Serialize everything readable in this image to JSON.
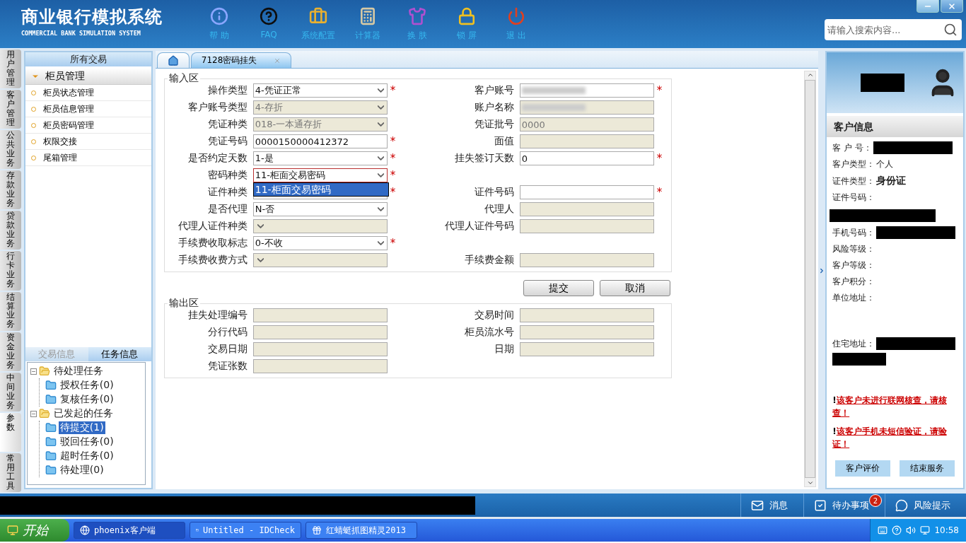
{
  "required_mark": "*",
  "header": {
    "title": "商业银行模拟系统",
    "subtitle": "COMMERCIAL BANK SIMULATION SYSTEM",
    "tools": [
      {
        "label": "帮 助",
        "kind": "info"
      },
      {
        "label": "FAQ",
        "kind": "help"
      },
      {
        "label": "系统配置",
        "kind": "toolbox"
      },
      {
        "label": "计算器",
        "kind": "calculator"
      },
      {
        "label": "换 肤",
        "kind": "shirt"
      },
      {
        "label": "锁 屏",
        "kind": "lock"
      },
      {
        "label": "退 出",
        "kind": "power"
      }
    ],
    "search": {
      "placeholder": "请输入搜索内容..."
    }
  },
  "vertical_tabs": [
    {
      "label": "用户管理",
      "selected": false
    },
    {
      "label": "客户管理",
      "selected": false
    },
    {
      "label": "公共业务",
      "selected": false
    },
    {
      "label": "存款业务",
      "selected": false
    },
    {
      "label": "贷款业务",
      "selected": false
    },
    {
      "label": "行卡业务",
      "selected": false
    },
    {
      "label": "结算业务",
      "selected": false
    },
    {
      "label": "资金业务",
      "selected": false
    },
    {
      "label": "中间业务",
      "selected": false
    },
    {
      "label": "参数",
      "selected": true
    },
    {
      "label": "常用工具",
      "selected": false
    }
  ],
  "left_panel": {
    "title": "所有交易",
    "section": {
      "label": "柜员管理",
      "expanded": true,
      "items": [
        "柜员状态管理",
        "柜员信息管理",
        "柜员密码管理",
        "权限交接",
        "尾箱管理"
      ]
    },
    "bottom_tabs": [
      {
        "label": "交易信息",
        "selected": false
      },
      {
        "label": "任务信息",
        "selected": true
      }
    ],
    "tree": [
      {
        "label": "待处理任务",
        "expanded": true,
        "children": [
          {
            "label": "授权任务(0)",
            "selected": false
          },
          {
            "label": "复核任务(0)",
            "selected": false
          }
        ]
      },
      {
        "label": "已发起的任务",
        "expanded": true,
        "children": [
          {
            "label": "待提交(1)",
            "selected": true
          },
          {
            "label": "驳回任务(0)",
            "selected": false
          },
          {
            "label": "超时任务(0)",
            "selected": false
          },
          {
            "label": "待处理(0)",
            "selected": false
          }
        ]
      }
    ]
  },
  "page_tabs": [
    {
      "kind": "home",
      "selected": false
    },
    {
      "kind": "page",
      "label": "7128密码挂失",
      "selected": true
    }
  ],
  "input": {
    "legend": "输入区",
    "rows": [
      {
        "left": {
          "label": "操作类型",
          "kind": "select",
          "value": "4-凭证正常",
          "disabled": false,
          "required": true
        },
        "right": {
          "label": "客户账号",
          "kind": "text",
          "redacted": true,
          "disabled": false,
          "required": true
        }
      },
      {
        "left": {
          "label": "客户账号类型",
          "kind": "select",
          "value": "4-存折",
          "disabled": true
        },
        "right": {
          "label": "账户名称",
          "kind": "text",
          "redacted": true,
          "disabled": true
        }
      },
      {
        "left": {
          "label": "凭证种类",
          "kind": "select",
          "value": "018-一本通存折",
          "disabled": true
        },
        "right": {
          "label": "凭证批号",
          "kind": "text",
          "value": "0000",
          "disabled": true
        }
      },
      {
        "left": {
          "label": "凭证号码",
          "kind": "text",
          "value": "0000150000412372",
          "disabled": false,
          "required": true
        },
        "right": {
          "label": "面值",
          "kind": "text",
          "disabled": true
        }
      },
      {
        "left": {
          "label": "是否约定天数",
          "kind": "select",
          "value": "1-是",
          "disabled": false,
          "required": true
        },
        "right": {
          "label": "挂失签订天数",
          "kind": "text",
          "value": "0",
          "disabled": false,
          "required": true
        }
      },
      {
        "left": {
          "label": "密码种类",
          "kind": "select",
          "value": "11-柜面交易密码",
          "disabled": false,
          "required": true,
          "open": true,
          "options": [
            {
              "label": "11-柜面交易密码",
              "selected": true
            }
          ]
        }
      },
      {
        "left": {
          "label": "证件种类",
          "kind": "select",
          "disabled": false,
          "required": true
        },
        "right": {
          "label": "证件号码",
          "kind": "text",
          "disabled": false,
          "required": true
        }
      },
      {
        "left": {
          "label": "是否代理",
          "kind": "select",
          "value": "N-否",
          "disabled": false
        },
        "right": {
          "label": "代理人",
          "kind": "text",
          "disabled": true
        }
      },
      {
        "left": {
          "label": "代理人证件种类",
          "kind": "select",
          "disabled": true
        },
        "right": {
          "label": "代理人证件号码",
          "kind": "text",
          "disabled": true
        }
      },
      {
        "left": {
          "label": "手续费收取标志",
          "kind": "select",
          "value": "0-不收",
          "disabled": false,
          "required": true
        }
      },
      {
        "left": {
          "label": "手续费收费方式",
          "kind": "select",
          "disabled": true
        },
        "right": {
          "label": "手续费金额",
          "kind": "text",
          "disabled": true
        }
      }
    ]
  },
  "buttons": [
    "提交",
    "取消"
  ],
  "output": {
    "legend": "输出区",
    "rows": [
      {
        "left": {
          "label": "挂失处理编号",
          "kind": "text",
          "disabled": true
        },
        "right": {
          "label": "交易时间",
          "kind": "text",
          "disabled": true
        }
      },
      {
        "left": {
          "label": "分行代码",
          "kind": "text",
          "disabled": true
        },
        "right": {
          "label": "柜员流水号",
          "kind": "text",
          "disabled": true
        }
      },
      {
        "left": {
          "label": "交易日期",
          "kind": "text",
          "disabled": true
        },
        "right": {
          "label": "日期",
          "kind": "text",
          "disabled": true
        }
      },
      {
        "left": {
          "label": "凭证张数",
          "kind": "text",
          "disabled": true
        }
      }
    ]
  },
  "customer": {
    "title": "客户信息",
    "items": [
      {
        "label": "客 户 号：",
        "kind": "redacted_inline"
      },
      {
        "label": "客户类型：",
        "kind": "text",
        "value": "个人"
      },
      {
        "label": "证件类型：",
        "kind": "bold",
        "value": "身份证"
      },
      {
        "label": "证件号码：",
        "kind": "redacted_below"
      },
      {
        "label": "手机号码：",
        "kind": "redacted_inline"
      },
      {
        "label": "风险等级：",
        "kind": "text"
      },
      {
        "label": "客户等级：",
        "kind": "text"
      },
      {
        "label": "客户积分：",
        "kind": "text"
      },
      {
        "label": "单位地址：",
        "kind": "tall"
      },
      {
        "label": "住宅地址：",
        "kind": "redacted_wrap"
      }
    ],
    "warnings": [
      {
        "mark": "!",
        "text": "该客户未进行联网核查，请核查！"
      },
      {
        "mark": "!",
        "text": "该客户手机未短信验证，请验证！"
      }
    ],
    "buttons": [
      "客户评价",
      "结束服务"
    ]
  },
  "status_bar": {
    "items": [
      {
        "label": "消息",
        "kind": "mail"
      },
      {
        "label": "待办事项",
        "kind": "check",
        "badge": "2"
      },
      {
        "label": "风险提示",
        "kind": "chat"
      }
    ]
  },
  "taskbar": {
    "start": "开始",
    "tasks": [
      {
        "label": "phoenix客户端",
        "selected": true,
        "kind": "globe"
      },
      {
        "label": "Untitled - IDCheck",
        "selected": false,
        "kind": "window"
      },
      {
        "label": "红蜻蜓抓图精灵2013",
        "selected": false,
        "kind": "gift"
      }
    ],
    "clock": "10:58"
  }
}
